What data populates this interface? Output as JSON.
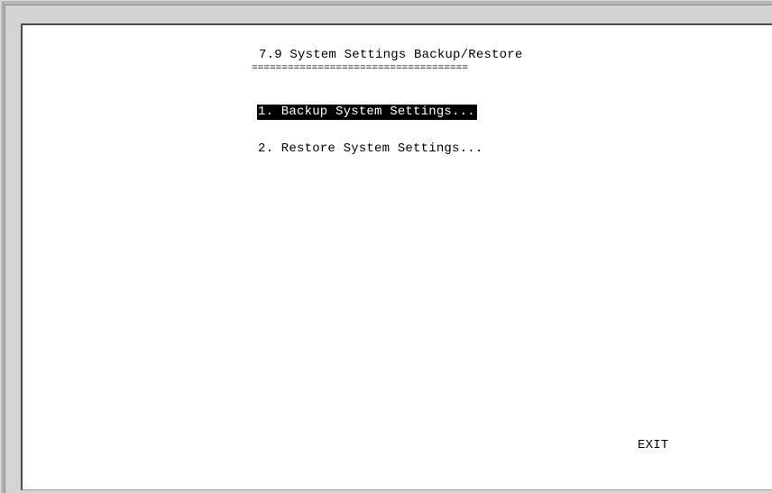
{
  "console": {
    "title": "7.9 System Settings Backup/Restore",
    "title_rule": "====================================",
    "menu": [
      {
        "label": "1. Backup System Settings...",
        "selected": true
      },
      {
        "label": "2. Restore System Settings...",
        "selected": false
      }
    ],
    "exit_label": "EXIT"
  },
  "colors": {
    "screen_background": "#ffffff",
    "text": "#000000",
    "selection_background": "#000000",
    "selection_text": "#ffffff",
    "window_frame": "#d4d4d4"
  }
}
